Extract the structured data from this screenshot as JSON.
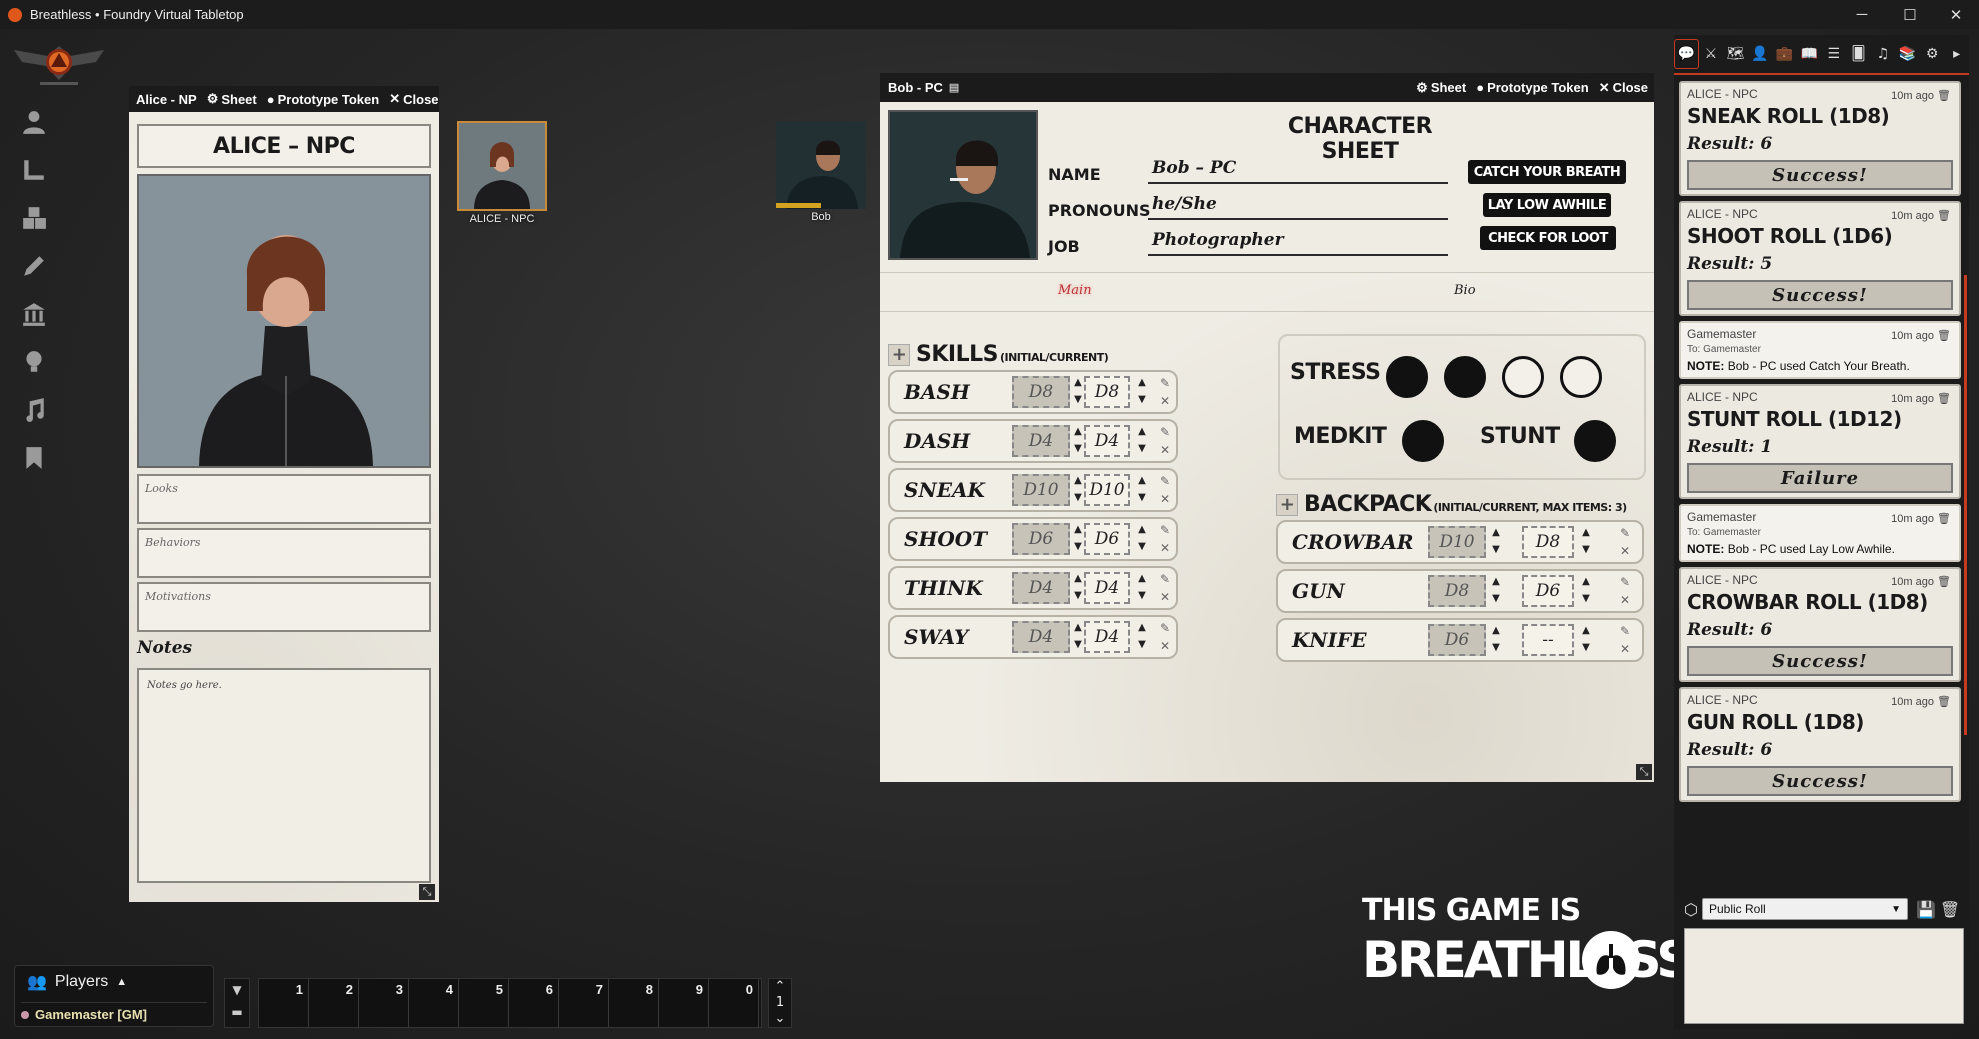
{
  "window": {
    "title": "Breathless • Foundry Virtual Tabletop",
    "minimize": "─",
    "maximize": "☐",
    "close": "✕"
  },
  "left_toolbar": {
    "tools": [
      "token-controls",
      "measure-controls",
      "tile-controls",
      "drawing-tools",
      "wall-controls",
      "lighting-controls",
      "sound-controls",
      "notes-controls"
    ]
  },
  "alice_sheet": {
    "header_title": "Alice - NP",
    "sheet_label": "Sheet",
    "token_label": "Prototype Token",
    "close_label": "Close",
    "name": "ALICE – NPC",
    "looks_placeholder": "Looks",
    "behaviors_placeholder": "Behaviors",
    "motivations_placeholder": "Motivations",
    "notes_label": "Notes",
    "notes_text": "Notes go here."
  },
  "tokens": {
    "alice": "ALICE - NPC",
    "bob": "Bob"
  },
  "bob_sheet": {
    "header_title": "Bob - PC",
    "sheet_label": "Sheet",
    "token_label": "Prototype Token",
    "close_label": "Close",
    "title": "CHARACTER SHEET",
    "name_label": "NAME",
    "name_value": "Bob – PC",
    "pronouns_label": "PRONOUNS",
    "pronouns_value": "he/She",
    "job_label": "JOB",
    "job_value": "Photographer",
    "buttons": {
      "catch": "CATCH YOUR BREATH",
      "laylow": "LAY LOW AWHILE",
      "loot": "CHECK FOR LOOT"
    },
    "tabs": {
      "main": "Main",
      "bio": "Bio"
    },
    "skills_title": "SKILLS",
    "skills_sub": "(INITIAL/CURRENT)",
    "skills": [
      {
        "name": "BASH",
        "initial": "D8",
        "current": "D8"
      },
      {
        "name": "DASH",
        "initial": "D4",
        "current": "D4"
      },
      {
        "name": "SNEAK",
        "initial": "D10",
        "current": "D10"
      },
      {
        "name": "SHOOT",
        "initial": "D6",
        "current": "D6"
      },
      {
        "name": "THINK",
        "initial": "D4",
        "current": "D4"
      },
      {
        "name": "SWAY",
        "initial": "D4",
        "current": "D4"
      }
    ],
    "stress_label": "STRESS",
    "stress_filled": 2,
    "stress_max": 4,
    "medkit_label": "MEDKIT",
    "stunt_label": "STUNT",
    "backpack_title": "BACKPACK",
    "backpack_sub": "(INITIAL/CURRENT, MAX ITEMS: 3)",
    "backpack": [
      {
        "name": "CROWBAR",
        "initial": "D10",
        "current": "D8"
      },
      {
        "name": "GUN",
        "initial": "D8",
        "current": "D6"
      },
      {
        "name": "KNIFE",
        "initial": "D6",
        "current": "--"
      }
    ]
  },
  "sidebar": {
    "tabs": [
      "chat",
      "combat",
      "scenes",
      "actors",
      "items",
      "journal",
      "tables",
      "cards",
      "playlists",
      "compendium",
      "settings",
      "collapse"
    ],
    "messages": [
      {
        "type": "roll",
        "speaker": "ALICE - NPC",
        "time": "10m ago",
        "title": "SNEAK ROLL (1D8)",
        "result": "Result: 6",
        "outcome": "Success!"
      },
      {
        "type": "roll",
        "speaker": "ALICE - NPC",
        "time": "10m ago",
        "title": "SHOOT ROLL (1D6)",
        "result": "Result: 5",
        "outcome": "Success!"
      },
      {
        "type": "note",
        "speaker": "Gamemaster",
        "time": "10m ago",
        "to": "To: Gamemaster",
        "note_label": "NOTE:",
        "note": "Bob - PC used Catch Your Breath."
      },
      {
        "type": "roll",
        "speaker": "ALICE - NPC",
        "time": "10m ago",
        "title": "STUNT ROLL (1D12)",
        "result": "Result: 1",
        "outcome": "Failure"
      },
      {
        "type": "note",
        "speaker": "Gamemaster",
        "time": "10m ago",
        "to": "To: Gamemaster",
        "note_label": "NOTE:",
        "note": "Bob - PC used Lay Low Awhile."
      },
      {
        "type": "roll",
        "speaker": "ALICE - NPC",
        "time": "10m ago",
        "title": "CROWBAR ROLL (1D8)",
        "result": "Result: 6",
        "outcome": "Success!"
      },
      {
        "type": "roll",
        "speaker": "ALICE - NPC",
        "time": "10m ago",
        "title": "GUN ROLL (1D8)",
        "result": "Result: 6",
        "outcome": "Success!"
      }
    ],
    "roll_mode": "Public Roll"
  },
  "players": {
    "title": "Players",
    "entry": "Gamemaster [GM]"
  },
  "hotbar": {
    "slots": [
      "1",
      "2",
      "3",
      "4",
      "5",
      "6",
      "7",
      "8",
      "9",
      "0"
    ],
    "page": "1"
  },
  "brand": {
    "line1": "THIS GAME IS",
    "line2": "BREATHLESS"
  },
  "colors": {
    "accent": "#c43b1f",
    "paper": "#efece4",
    "ink": "#111111"
  }
}
